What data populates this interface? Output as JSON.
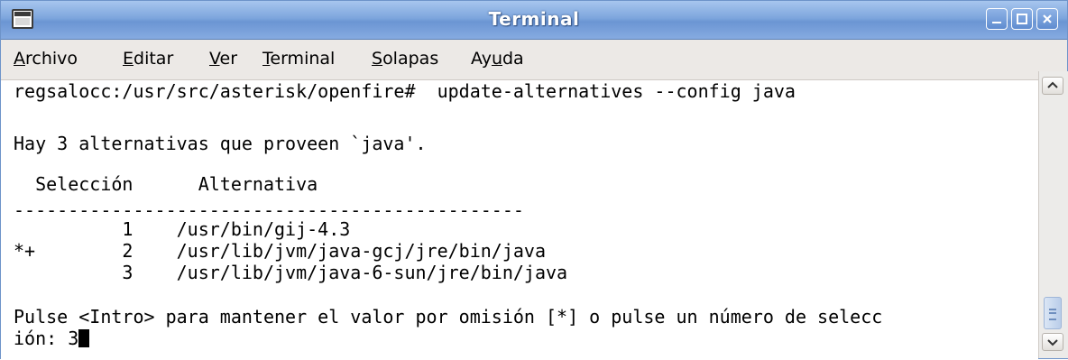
{
  "window": {
    "title": "Terminal",
    "icon": "terminal-icon",
    "accent": "#7ea6dd"
  },
  "menu": {
    "archivo": {
      "mnemonic": "A",
      "rest": "rchivo"
    },
    "editar": {
      "mnemonic": "E",
      "rest": "ditar"
    },
    "ver": {
      "mnemonic": "V",
      "rest": "er"
    },
    "terminal": {
      "mnemonic": "T",
      "rest": "erminal"
    },
    "solapas": {
      "mnemonic": "S",
      "rest": "olapas"
    },
    "ayuda": {
      "pre": "Ay",
      "mnemonic": "u",
      "post": "da"
    }
  },
  "terminal": {
    "lines": [
      "regsalocc:/usr/src/asterisk/openfire#  update-alternatives --config java",
      "",
      "Hay 3 alternativas que proveen `java'.",
      "",
      "  Selección      Alternativa",
      "-----------------------------------------------",
      "          1    /usr/bin/gij-4.3",
      "*+        2    /usr/lib/jvm/java-gcj/jre/bin/java",
      "          3    /usr/lib/jvm/java-6-sun/jre/bin/java",
      "",
      "Pulse <Intro> para mantener el valor por omisión [*] o pulse un número de selecc",
      "ión: 3"
    ]
  }
}
